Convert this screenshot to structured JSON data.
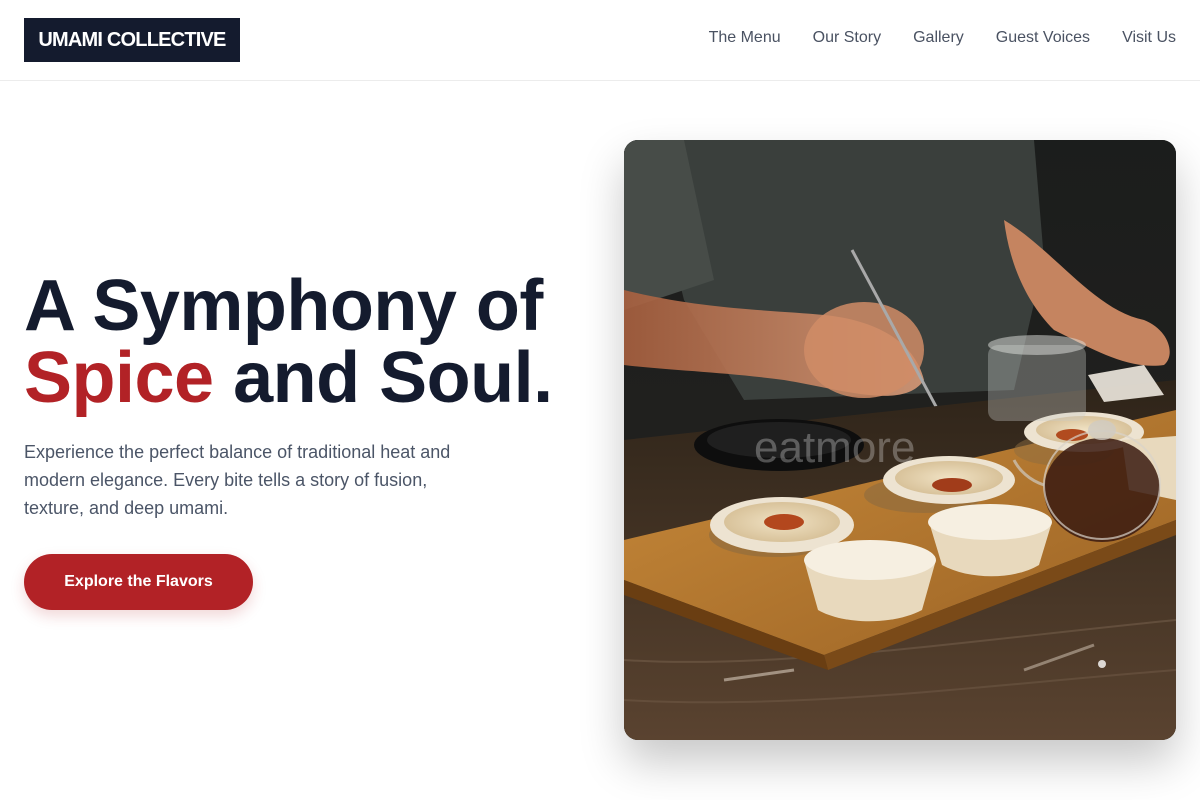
{
  "brand": {
    "name": "UMAMI COLLECTIVE"
  },
  "nav": {
    "items": [
      {
        "label": "The Menu"
      },
      {
        "label": "Our Story"
      },
      {
        "label": "Gallery"
      },
      {
        "label": "Guest Voices"
      },
      {
        "label": "Visit Us"
      }
    ]
  },
  "hero": {
    "title_line1": "A Symphony of",
    "title_accent": "Spice",
    "title_rest": " and Soul.",
    "subtitle": "Experience the perfect balance of traditional heat and modern elegance. Every bite tells a story of fusion, texture, and deep umami.",
    "cta_label": "Explore the Flavors",
    "image_watermark": "eatmore"
  },
  "colors": {
    "brand_navy": "#141b2e",
    "accent_red": "#b22226",
    "body_text": "#4b5567"
  }
}
